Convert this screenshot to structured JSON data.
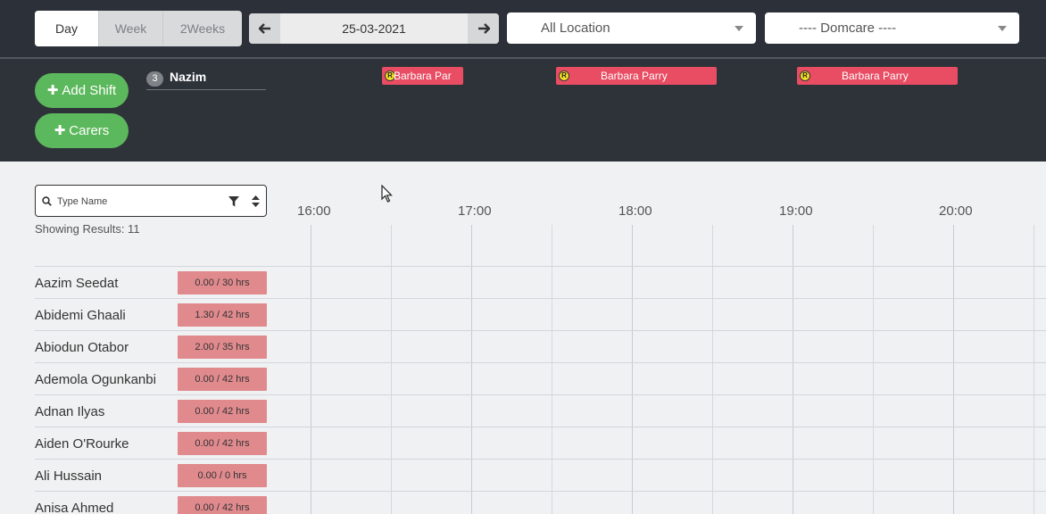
{
  "view_toggle": {
    "day": "Day",
    "week": "Week",
    "two_weeks": "2Weeks"
  },
  "date_nav": {
    "date": "25-03-2021"
  },
  "location_select": {
    "value": "All Location"
  },
  "company_select": {
    "value": "---- Domcare ----"
  },
  "actions": {
    "add_shift": "Add Shift",
    "carers": "Carers"
  },
  "carer": {
    "count": "3",
    "name": "Nazim"
  },
  "shifts": [
    {
      "badge": "R",
      "label": "Barbara Par"
    },
    {
      "badge": "R",
      "label": "Barbara Parry"
    },
    {
      "badge": "R",
      "label": "Barbara Parry"
    }
  ],
  "search": {
    "placeholder": "Type Name"
  },
  "results": {
    "text": "Showing Results: 11"
  },
  "timeline": {
    "hours": [
      "16:00",
      "17:00",
      "18:00",
      "19:00",
      "20:00"
    ]
  },
  "staff": [
    {
      "name": "Aazim Seedat",
      "hours": "0.00 / 30 hrs"
    },
    {
      "name": "Abidemi Ghaali",
      "hours": "1.30 / 42 hrs"
    },
    {
      "name": "Abiodun Otabor",
      "hours": "2.00 / 35 hrs"
    },
    {
      "name": "Ademola Ogunkanbi",
      "hours": "0.00 / 42 hrs"
    },
    {
      "name": "Adnan Ilyas",
      "hours": "0.00 / 42 hrs"
    },
    {
      "name": "Aiden O'Rourke",
      "hours": "0.00 / 42 hrs"
    },
    {
      "name": "Ali Hussain",
      "hours": "0.00 / 0 hrs"
    },
    {
      "name": "Anisa Ahmed",
      "hours": "0.00 / 42 hrs"
    }
  ],
  "colors": {
    "shift": "#e84d63",
    "hours_badge": "#e08a8e",
    "green": "#5cb85c",
    "dark": "#2e333a"
  }
}
